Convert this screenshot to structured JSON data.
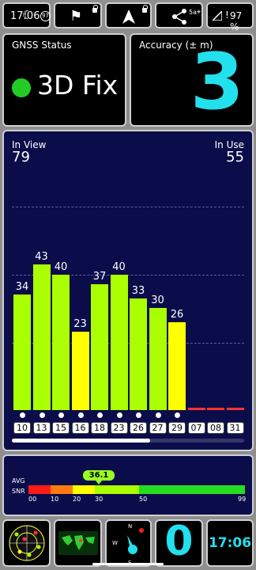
{
  "status_bar": {
    "time": "17:06",
    "signal_indicator": "5a",
    "battery": "97 %",
    "badge": "97"
  },
  "gnss_status": {
    "label": "GNSS Status",
    "value": "3D Fix",
    "indicator_color": "#22cc22"
  },
  "accuracy": {
    "label": "Accuracy (± m)",
    "value": "3",
    "value_color": "#22e0ee"
  },
  "satellites": {
    "in_view_label": "In View",
    "in_view": "79",
    "in_use_label": "In Use",
    "in_use": "55"
  },
  "chart_data": {
    "type": "bar",
    "categories": [
      "10",
      "13",
      "15",
      "16",
      "18",
      "23",
      "26",
      "27",
      "29",
      "07",
      "08",
      "31"
    ],
    "values": [
      34,
      43,
      40,
      23,
      37,
      40,
      33,
      30,
      26,
      0,
      0,
      0
    ],
    "value_labels": [
      "34",
      "43",
      "40",
      "23",
      "37",
      "40",
      "33",
      "30",
      "26",
      "",
      "",
      ""
    ],
    "colors": [
      "#aaff00",
      "#aaff00",
      "#aaff00",
      "#ffff00",
      "#aaff00",
      "#aaff00",
      "#aaff00",
      "#aaff00",
      "#ffff00",
      "#ff3333",
      "#ff3333",
      "#ff3333"
    ],
    "ylim": [
      0,
      80
    ],
    "grid": true
  },
  "snr_scale": {
    "avg_label": "AVG",
    "snr_label": "SNR",
    "avg_value": "36.1",
    "ticks": [
      "00",
      "10",
      "20",
      "30",
      "50",
      "99"
    ]
  },
  "bottom_bar": {
    "satellites_count": "0",
    "clock": "17:06"
  }
}
